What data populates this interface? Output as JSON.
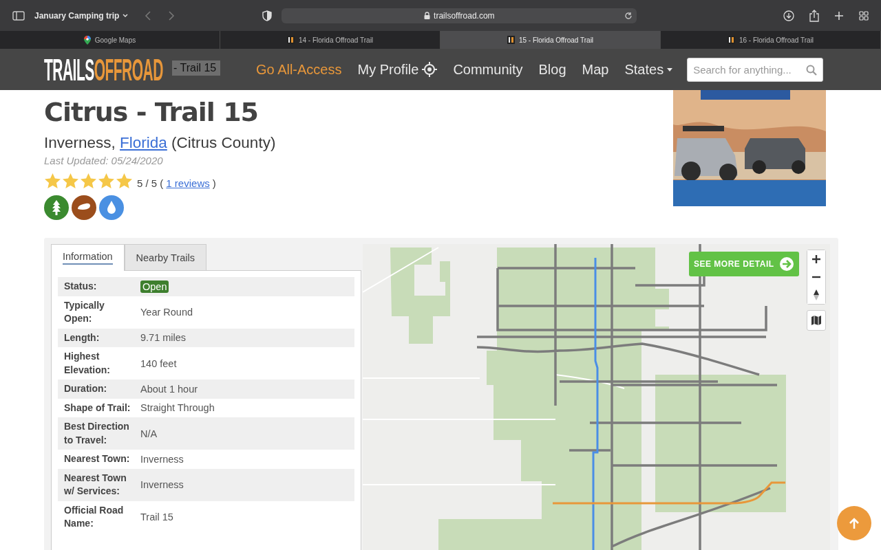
{
  "browser": {
    "tab_group": "January Camping trip",
    "url": "trailsoffroad.com",
    "tabs": [
      {
        "label": "Google Maps",
        "selected": false,
        "kind": "maps"
      },
      {
        "label": "14 - Florida Offroad Trail",
        "selected": false,
        "kind": "site"
      },
      {
        "label": "15 - Florida Offroad Trail",
        "selected": true,
        "kind": "site"
      },
      {
        "label": "16 - Florida Offroad Trail",
        "selected": false,
        "kind": "site"
      }
    ]
  },
  "site_nav": {
    "logo": {
      "light": "TRAILS",
      "accent": "OFFROAD"
    },
    "breadcrumb": "- Trail 15",
    "items": [
      {
        "label": "Go All-Access",
        "kind": "highlight"
      },
      {
        "label": "My Profile",
        "kind": "profile"
      },
      {
        "label": "Community",
        "kind": "link"
      },
      {
        "label": "Blog",
        "kind": "link"
      },
      {
        "label": "Map",
        "kind": "link"
      },
      {
        "label": "States",
        "kind": "dropdown"
      }
    ],
    "search": {
      "placeholder": "Search for anything..."
    }
  },
  "trail": {
    "title": "Citrus - Trail 15",
    "town": "Inverness,",
    "state_link": "Florida",
    "county": "(Citrus County)",
    "last_updated": "Last Updated: 05/24/2020",
    "stars": 5,
    "rating": "5 / 5 (",
    "reviews_link": "1 reviews",
    "rating_end": ")",
    "features": [
      {
        "kind": "forest",
        "color": "#3b8a2f"
      },
      {
        "kind": "mud",
        "color": "#9b4d1c"
      },
      {
        "kind": "water",
        "color": "#4a90e2"
      }
    ]
  },
  "info_tabs": [
    {
      "label": "Information",
      "selected": true
    },
    {
      "label": "Nearby Trails",
      "selected": false
    }
  ],
  "details": [
    {
      "label": "Status:",
      "value": "Open",
      "kind": "badge"
    },
    {
      "label": "Typically Open:",
      "value": "Year Round",
      "kind": "text"
    },
    {
      "label": "Length:",
      "value": "9.71 miles",
      "kind": "text"
    },
    {
      "label": "Highest Elevation:",
      "value": "140 feet",
      "kind": "text"
    },
    {
      "label": "Duration:",
      "value": "About 1 hour",
      "kind": "text"
    },
    {
      "label": "Shape of Trail:",
      "value": "Straight Through",
      "kind": "text"
    },
    {
      "label": "Best Direction to Travel:",
      "value": "N/A",
      "kind": "text"
    },
    {
      "label": "Nearest Town:",
      "value": "Inverness",
      "kind": "text"
    },
    {
      "label": "Nearest Town w/ Services:",
      "value": "Inverness",
      "kind": "text"
    },
    {
      "label": "Official Road Name:",
      "value": "Trail 15",
      "kind": "text"
    }
  ],
  "map": {
    "kind": "picture",
    "detail_button": "SEE MORE DETAIL"
  }
}
